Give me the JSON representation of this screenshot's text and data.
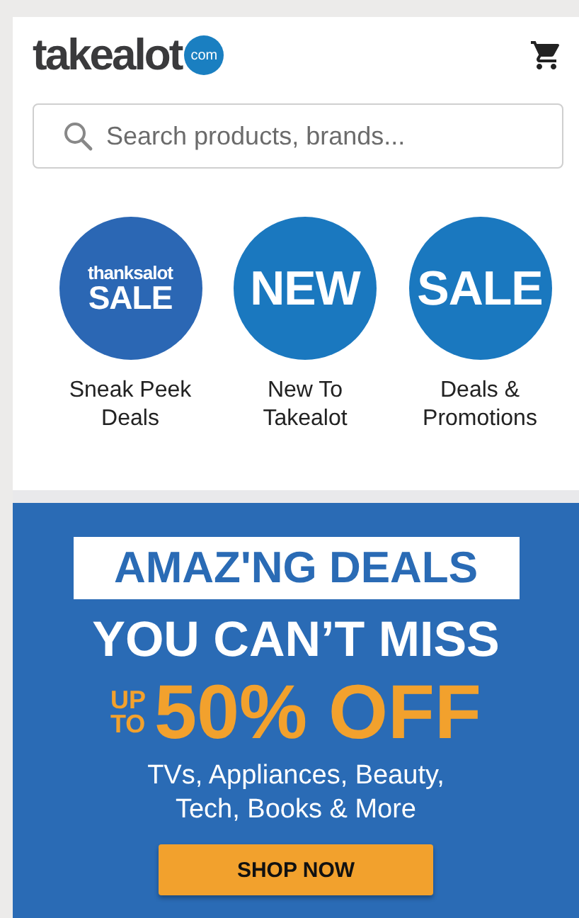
{
  "header": {
    "logo": "takealot",
    "logo_badge": "com"
  },
  "search": {
    "placeholder": "Search products, brands..."
  },
  "categories": [
    {
      "badge_small": "thanksalot",
      "badge": "SALE",
      "label": "Sneak Peek Deals"
    },
    {
      "badge": "NEW",
      "label": "New To Takealot"
    },
    {
      "badge": "SALE",
      "label": "Deals & Promotions"
    }
  ],
  "banner": {
    "headline": "AMAZ'NG DEALS",
    "subheadline": "YOU CAN’T MISS",
    "prefix_top": "UP",
    "prefix_bottom": "TO",
    "offer": "50% OFF",
    "description": "TVs, Appliances, Beauty, Tech, Books & More",
    "button": "SHOP NOW"
  }
}
